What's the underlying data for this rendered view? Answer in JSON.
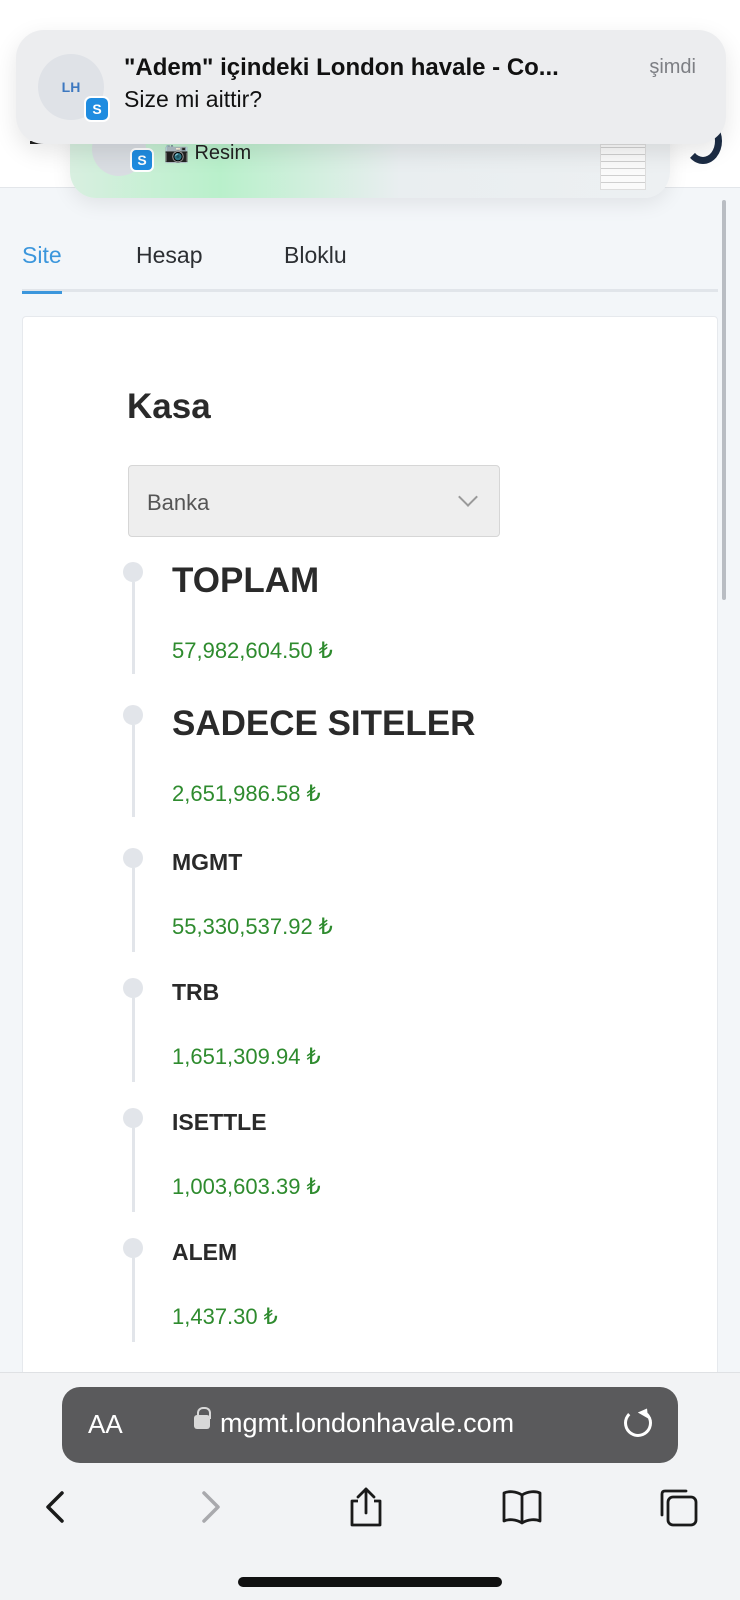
{
  "notification_back": {
    "badge": "S",
    "text": "📷 Resim"
  },
  "notification": {
    "avatar_initials": "LH",
    "badge": "S",
    "title": "\"Adem\" içindeki London havale - Co...",
    "body": "Size mi aittir?",
    "time": "şimdi"
  },
  "tabs": [
    {
      "label": "Site",
      "active": true
    },
    {
      "label": "Hesap",
      "active": false
    },
    {
      "label": "Bloklu",
      "active": false
    }
  ],
  "kasa": {
    "title": "Kasa",
    "select_value": "Banka",
    "entries": [
      {
        "label": "TOPLAM",
        "amount": "57,982,604.50 ₺"
      },
      {
        "label": "SADECE SITELER",
        "amount": "2,651,986.58 ₺"
      },
      {
        "label": "MGMT",
        "amount": "55,330,537.92 ₺"
      },
      {
        "label": "TRB",
        "amount": "1,651,309.94 ₺"
      },
      {
        "label": "ISETTLE",
        "amount": "1,003,603.39 ₺"
      },
      {
        "label": "ALEM",
        "amount": "1,437.30 ₺"
      }
    ]
  },
  "browser": {
    "aa": "AA",
    "url": "mgmt.londonhavale.com"
  },
  "colors": {
    "accent": "#3b96dc",
    "amount": "#2e8b2e",
    "url_bar": "#5a5a5c"
  }
}
